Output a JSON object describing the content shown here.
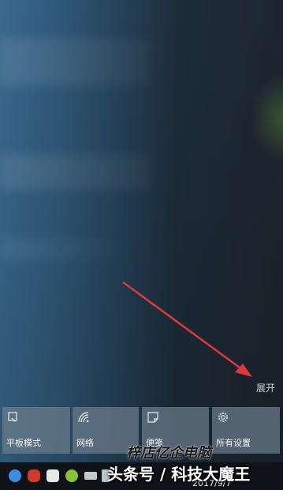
{
  "expand_label": "展开",
  "tiles": [
    {
      "label": "平板模式",
      "icon": "tablet-mode-icon"
    },
    {
      "label": "网络",
      "icon": "network-icon"
    },
    {
      "label": "便笺",
      "icon": "note-icon"
    },
    {
      "label": "所有设置",
      "icon": "gear-icon"
    }
  ],
  "taskbar": {
    "time_partial": "2017/9/7",
    "tray_icons": [
      "chat-icon",
      "penguin-icon",
      "message-icon",
      "plus-icon",
      "battery-icon",
      "network-tray-icon"
    ]
  },
  "watermarks": {
    "overlay_top": "梓店亿企电脑",
    "overlay_bottom": "头条号 / 科技大魔王"
  },
  "colors": {
    "arrow": "#e0383a",
    "tile_bg": "#6e7d8c"
  }
}
